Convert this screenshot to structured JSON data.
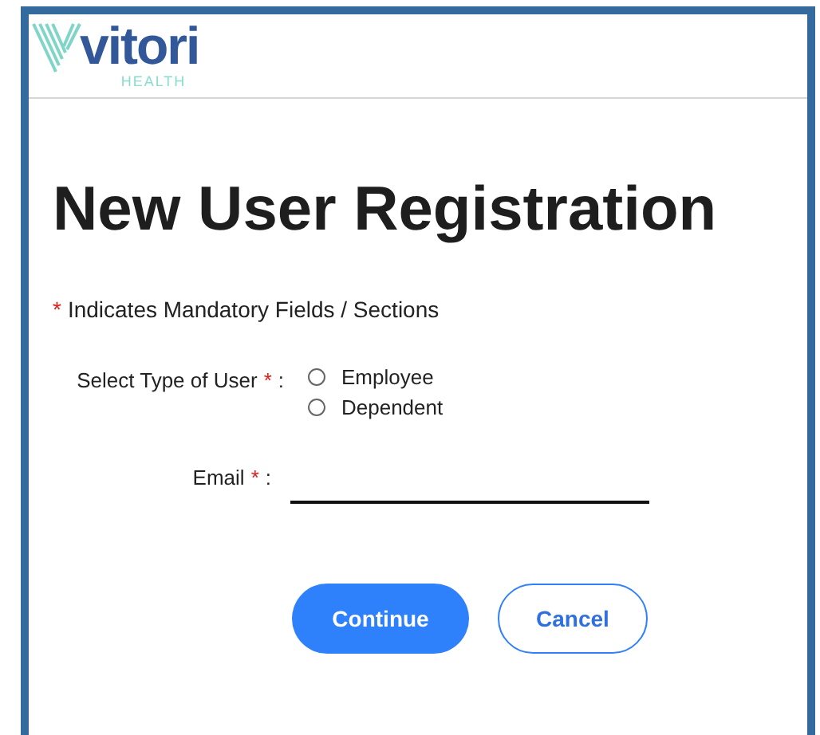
{
  "logo": {
    "wordmark": "vitori",
    "tagline": "HEALTH"
  },
  "title": "New User Registration",
  "mandatory_note": {
    "marker": "*",
    "text": "Indicates Mandatory Fields / Sections"
  },
  "user_type": {
    "label": "Select Type of User",
    "marker": "*",
    "colon": ":",
    "options": [
      {
        "label": "Employee",
        "selected": false
      },
      {
        "label": "Dependent",
        "selected": false
      }
    ]
  },
  "email": {
    "label": "Email",
    "marker": "*",
    "colon": ":"
  },
  "buttons": [
    {
      "label": "Continue",
      "kind": "primary"
    },
    {
      "label": "Cancel",
      "kind": "secondary"
    }
  ]
}
